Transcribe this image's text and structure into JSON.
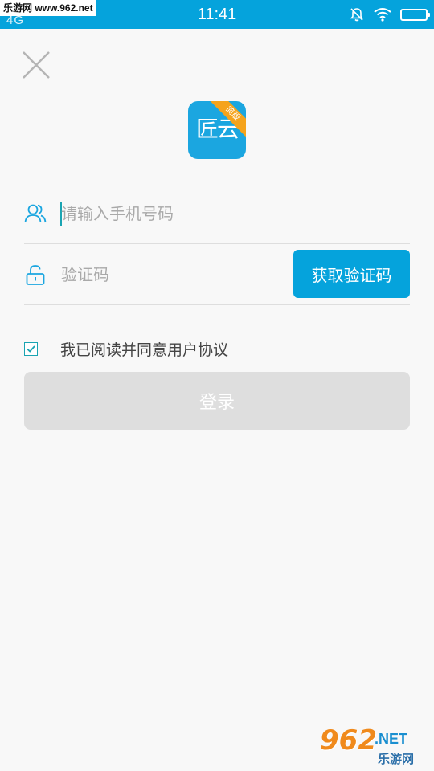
{
  "status_bar": {
    "watermark": "乐游网 www.962.net",
    "network": "4G",
    "time": "11:41",
    "icons": [
      "mute-bell-icon",
      "wifi-icon",
      "battery-icon"
    ]
  },
  "logo": {
    "text": "匠云",
    "ribbon": "简版"
  },
  "form": {
    "phone_placeholder": "请输入手机号码",
    "code_placeholder": "验证码",
    "get_code_label": "获取验证码",
    "agreement_label": "我已阅读并同意用户协议",
    "agreement_checked": true,
    "login_label": "登录"
  },
  "watermark_bottom": {
    "number": "962",
    "net": ".NET",
    "name": "乐游网"
  },
  "colors": {
    "primary": "#05a3dc",
    "accent": "#1aa4b2",
    "disabled": "#dedede",
    "ribbon": "#f5a31b"
  }
}
